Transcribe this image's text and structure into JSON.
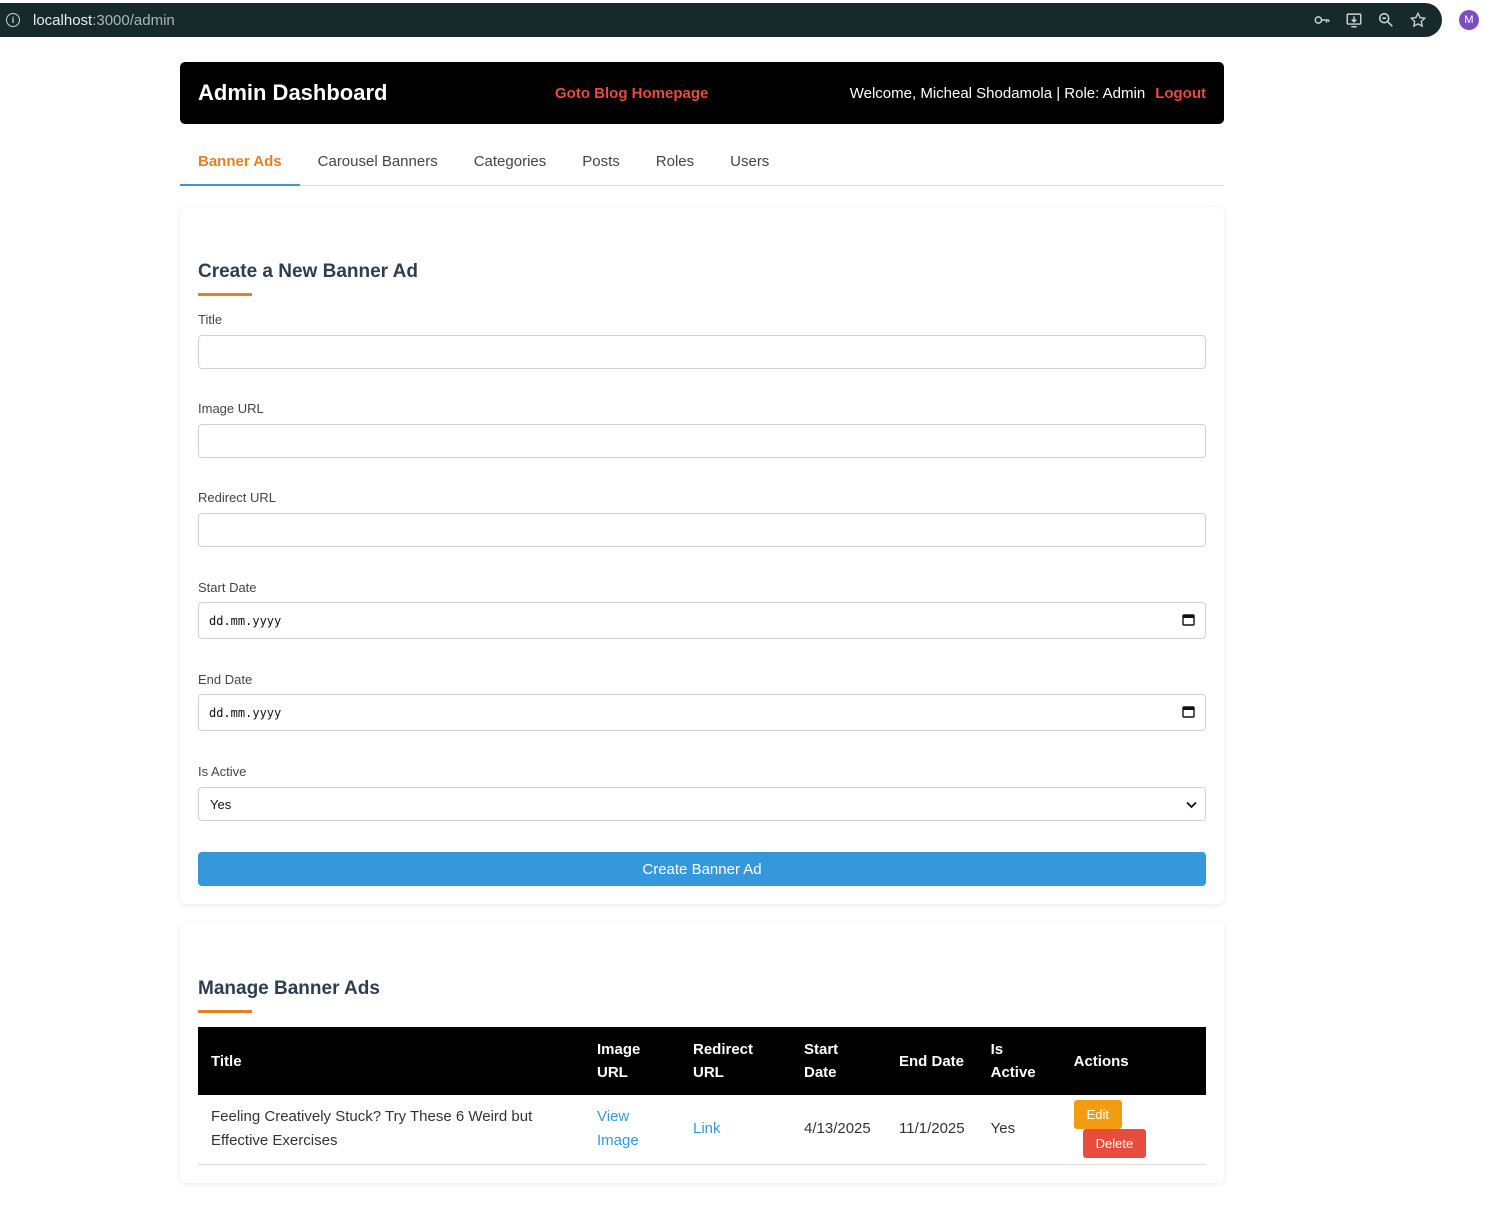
{
  "browser": {
    "url_host": "localhost",
    "url_path": ":3000/admin",
    "profile_initial": "M"
  },
  "header": {
    "title": "Admin Dashboard",
    "blog_link": "Goto Blog Homepage",
    "welcome": "Welcome, Micheal Shodamola | Role: Admin",
    "logout": "Logout"
  },
  "tabs": [
    {
      "label": "Banner Ads",
      "active": true
    },
    {
      "label": "Carousel Banners"
    },
    {
      "label": "Categories"
    },
    {
      "label": "Posts"
    },
    {
      "label": "Roles"
    },
    {
      "label": "Users"
    }
  ],
  "form": {
    "title": "Create a New Banner Ad",
    "title_label": "Title",
    "image_url_label": "Image URL",
    "redirect_url_label": "Redirect URL",
    "start_date_label": "Start Date",
    "start_date_placeholder": "dd.mm.yyyy",
    "end_date_label": "End Date",
    "end_date_placeholder": "dd.mm.yyyy",
    "is_active_label": "Is Active",
    "is_active_value": "Yes",
    "submit": "Create Banner Ad"
  },
  "manage": {
    "title": "Manage Banner Ads",
    "columns": [
      "Title",
      "Image URL",
      "Redirect URL",
      "Start Date",
      "End Date",
      "Is Active",
      "Actions"
    ],
    "rows": [
      {
        "title": "Feeling Creatively Stuck? Try These 6 Weird but Effective Exercises",
        "image": "View Image",
        "redirect": "Link",
        "start": "4/13/2025",
        "end": "11/1/2025",
        "active": "Yes",
        "edit": "Edit",
        "delete": "Delete"
      }
    ]
  },
  "colors": {
    "accent_orange": "#e67e22",
    "primary_blue": "#3498db",
    "danger_red": "#e74c3c",
    "warning_orange": "#f39c12",
    "header_black": "#000000"
  }
}
